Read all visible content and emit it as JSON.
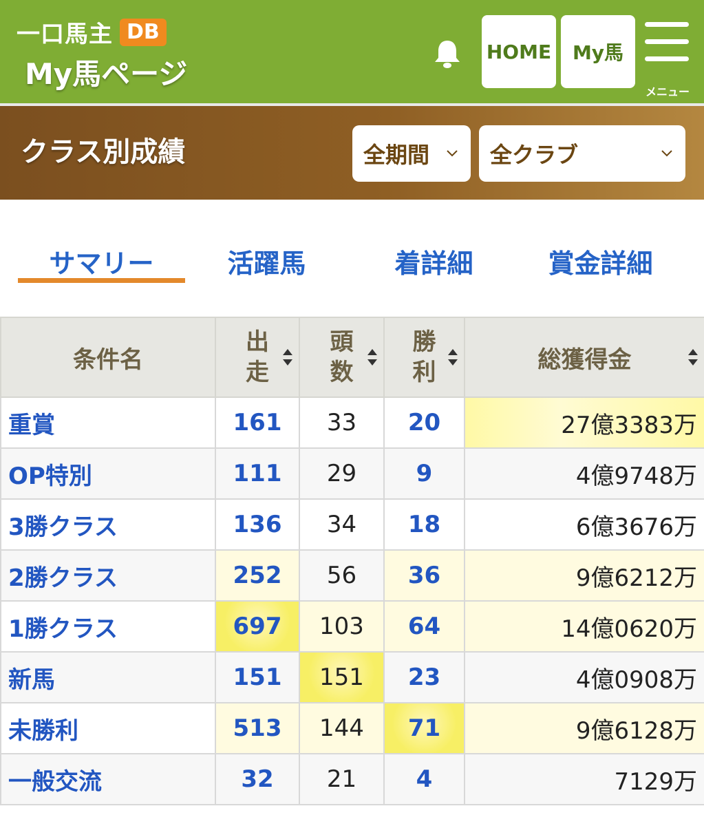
{
  "header": {
    "logo_text": "一口馬主",
    "logo_badge": "DB",
    "page_title": "My馬ページ",
    "home_label": "HOME",
    "myba_label": "My馬",
    "menu_label": "メニュー"
  },
  "classbar": {
    "title": "クラス別成績",
    "period_value": "全期間",
    "club_value": "全クラブ"
  },
  "tabs": [
    {
      "label": "サマリー",
      "active": true
    },
    {
      "label": "活躍馬",
      "active": false
    },
    {
      "label": "着詳細",
      "active": false
    },
    {
      "label": "賞金詳細",
      "active": false
    }
  ],
  "table": {
    "headers": {
      "name": "条件名",
      "starts_1": "出",
      "starts_2": "走",
      "heads_1": "頭",
      "heads_2": "数",
      "wins_1": "勝",
      "wins_2": "利",
      "prize": "総獲得金"
    },
    "rows": [
      {
        "name": "重賞",
        "starts": "161",
        "heads": "33",
        "wins": "20",
        "prize": "27億3383万"
      },
      {
        "name": "OP特別",
        "starts": "111",
        "heads": "29",
        "wins": "9",
        "prize": "4億9748万"
      },
      {
        "name": "3勝クラス",
        "starts": "136",
        "heads": "34",
        "wins": "18",
        "prize": "6億3676万"
      },
      {
        "name": "2勝クラス",
        "starts": "252",
        "heads": "56",
        "wins": "36",
        "prize": "9億6212万"
      },
      {
        "name": "1勝クラス",
        "starts": "697",
        "heads": "103",
        "wins": "64",
        "prize": "14億0620万"
      },
      {
        "name": "新馬",
        "starts": "151",
        "heads": "151",
        "wins": "23",
        "prize": "4億0908万"
      },
      {
        "name": "未勝利",
        "starts": "513",
        "heads": "144",
        "wins": "71",
        "prize": "9億6128万"
      },
      {
        "name": "一般交流",
        "starts": "32",
        "heads": "21",
        "wins": "4",
        "prize": "7129万"
      }
    ]
  },
  "colors": {
    "header_green": "#7fad34",
    "classbar_brown": "#7b4f1f",
    "tab_blue": "#2563c7",
    "tab_underline": "#e3892b",
    "highlight_yellow": "#f7ef65"
  }
}
